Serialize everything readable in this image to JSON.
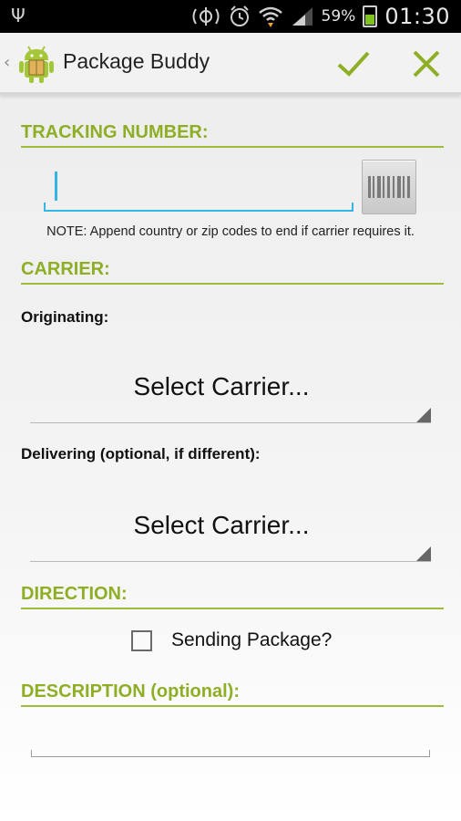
{
  "status_bar": {
    "battery_percent": "59%",
    "time": "01:30",
    "icons": [
      "usb-icon",
      "nfc-icon",
      "alarm-icon",
      "wifi-icon",
      "signal-icon",
      "battery-charging-icon"
    ]
  },
  "action_bar": {
    "title": "Package Buddy",
    "confirm_icon": "check-icon",
    "cancel_icon": "close-icon",
    "accent": "#8eaf25"
  },
  "tracking": {
    "header": "TRACKING NUMBER:",
    "value": "",
    "note": "NOTE: Append country or zip codes to end if carrier requires it."
  },
  "carrier": {
    "header": "CARRIER:",
    "originating_label": "Originating:",
    "originating_value": "Select Carrier...",
    "delivering_label": "Delivering (optional, if different):",
    "delivering_value": "Select Carrier..."
  },
  "direction": {
    "header": "DIRECTION:",
    "sending_label": "Sending Package?",
    "sending_checked": false
  },
  "description": {
    "header": "DESCRIPTION (optional):",
    "value": ""
  },
  "colors": {
    "section_accent": "#8eaf25",
    "focus_accent": "#33b5e5"
  }
}
